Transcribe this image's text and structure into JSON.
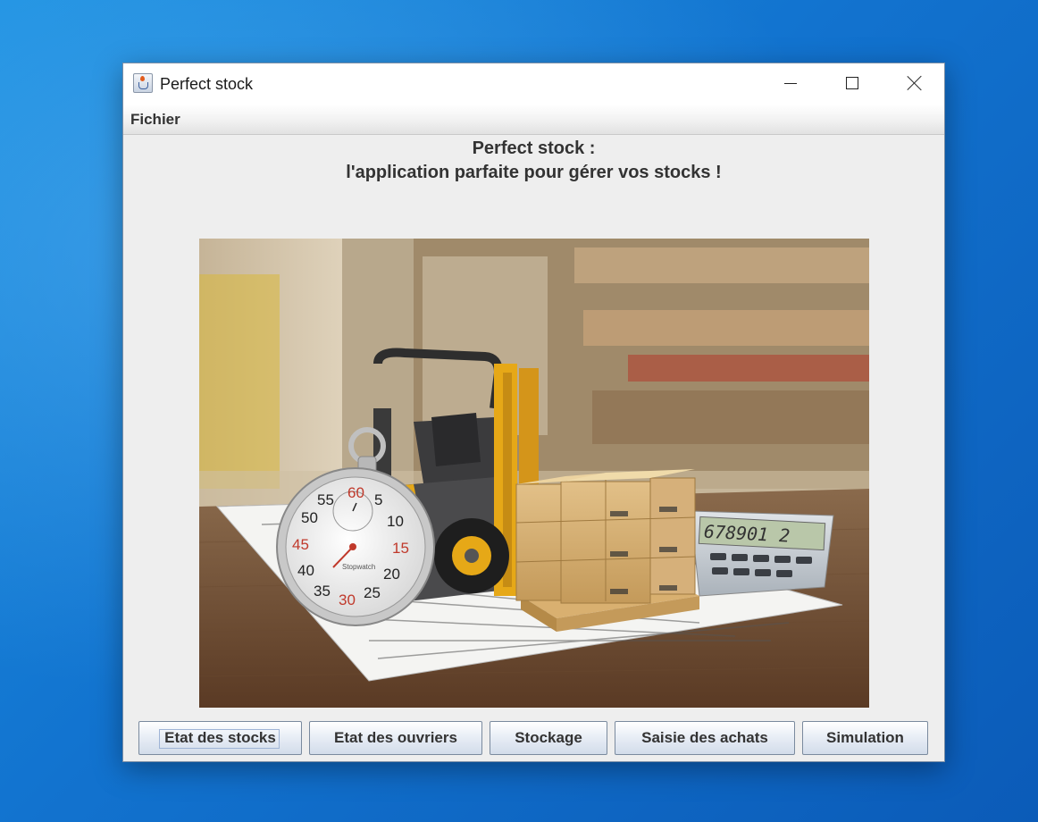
{
  "window": {
    "title": "Perfect stock"
  },
  "menu": {
    "items": [
      "Fichier"
    ]
  },
  "heading": {
    "line1": "Perfect stock :",
    "line2": "l'application parfaite pour gérer vos stocks !"
  },
  "illustration": {
    "stopwatch_label": "Stopwatch",
    "stopwatch_numbers": [
      "60",
      "5",
      "10",
      "15",
      "20",
      "25",
      "30",
      "35",
      "40",
      "45",
      "50",
      "55"
    ],
    "calculator_display": "678901 2"
  },
  "buttons": [
    {
      "label": "Etat des stocks",
      "focused": true
    },
    {
      "label": "Etat des ouvriers",
      "focused": false
    },
    {
      "label": "Stockage",
      "focused": false
    },
    {
      "label": "Saisie des achats",
      "focused": false
    },
    {
      "label": "Simulation",
      "focused": false
    }
  ],
  "colors": {
    "desktop": "#1273cf",
    "window_bg": "#eeeeee",
    "button_border": "#7a8a9e",
    "forklift_yellow": "#e6a817"
  }
}
